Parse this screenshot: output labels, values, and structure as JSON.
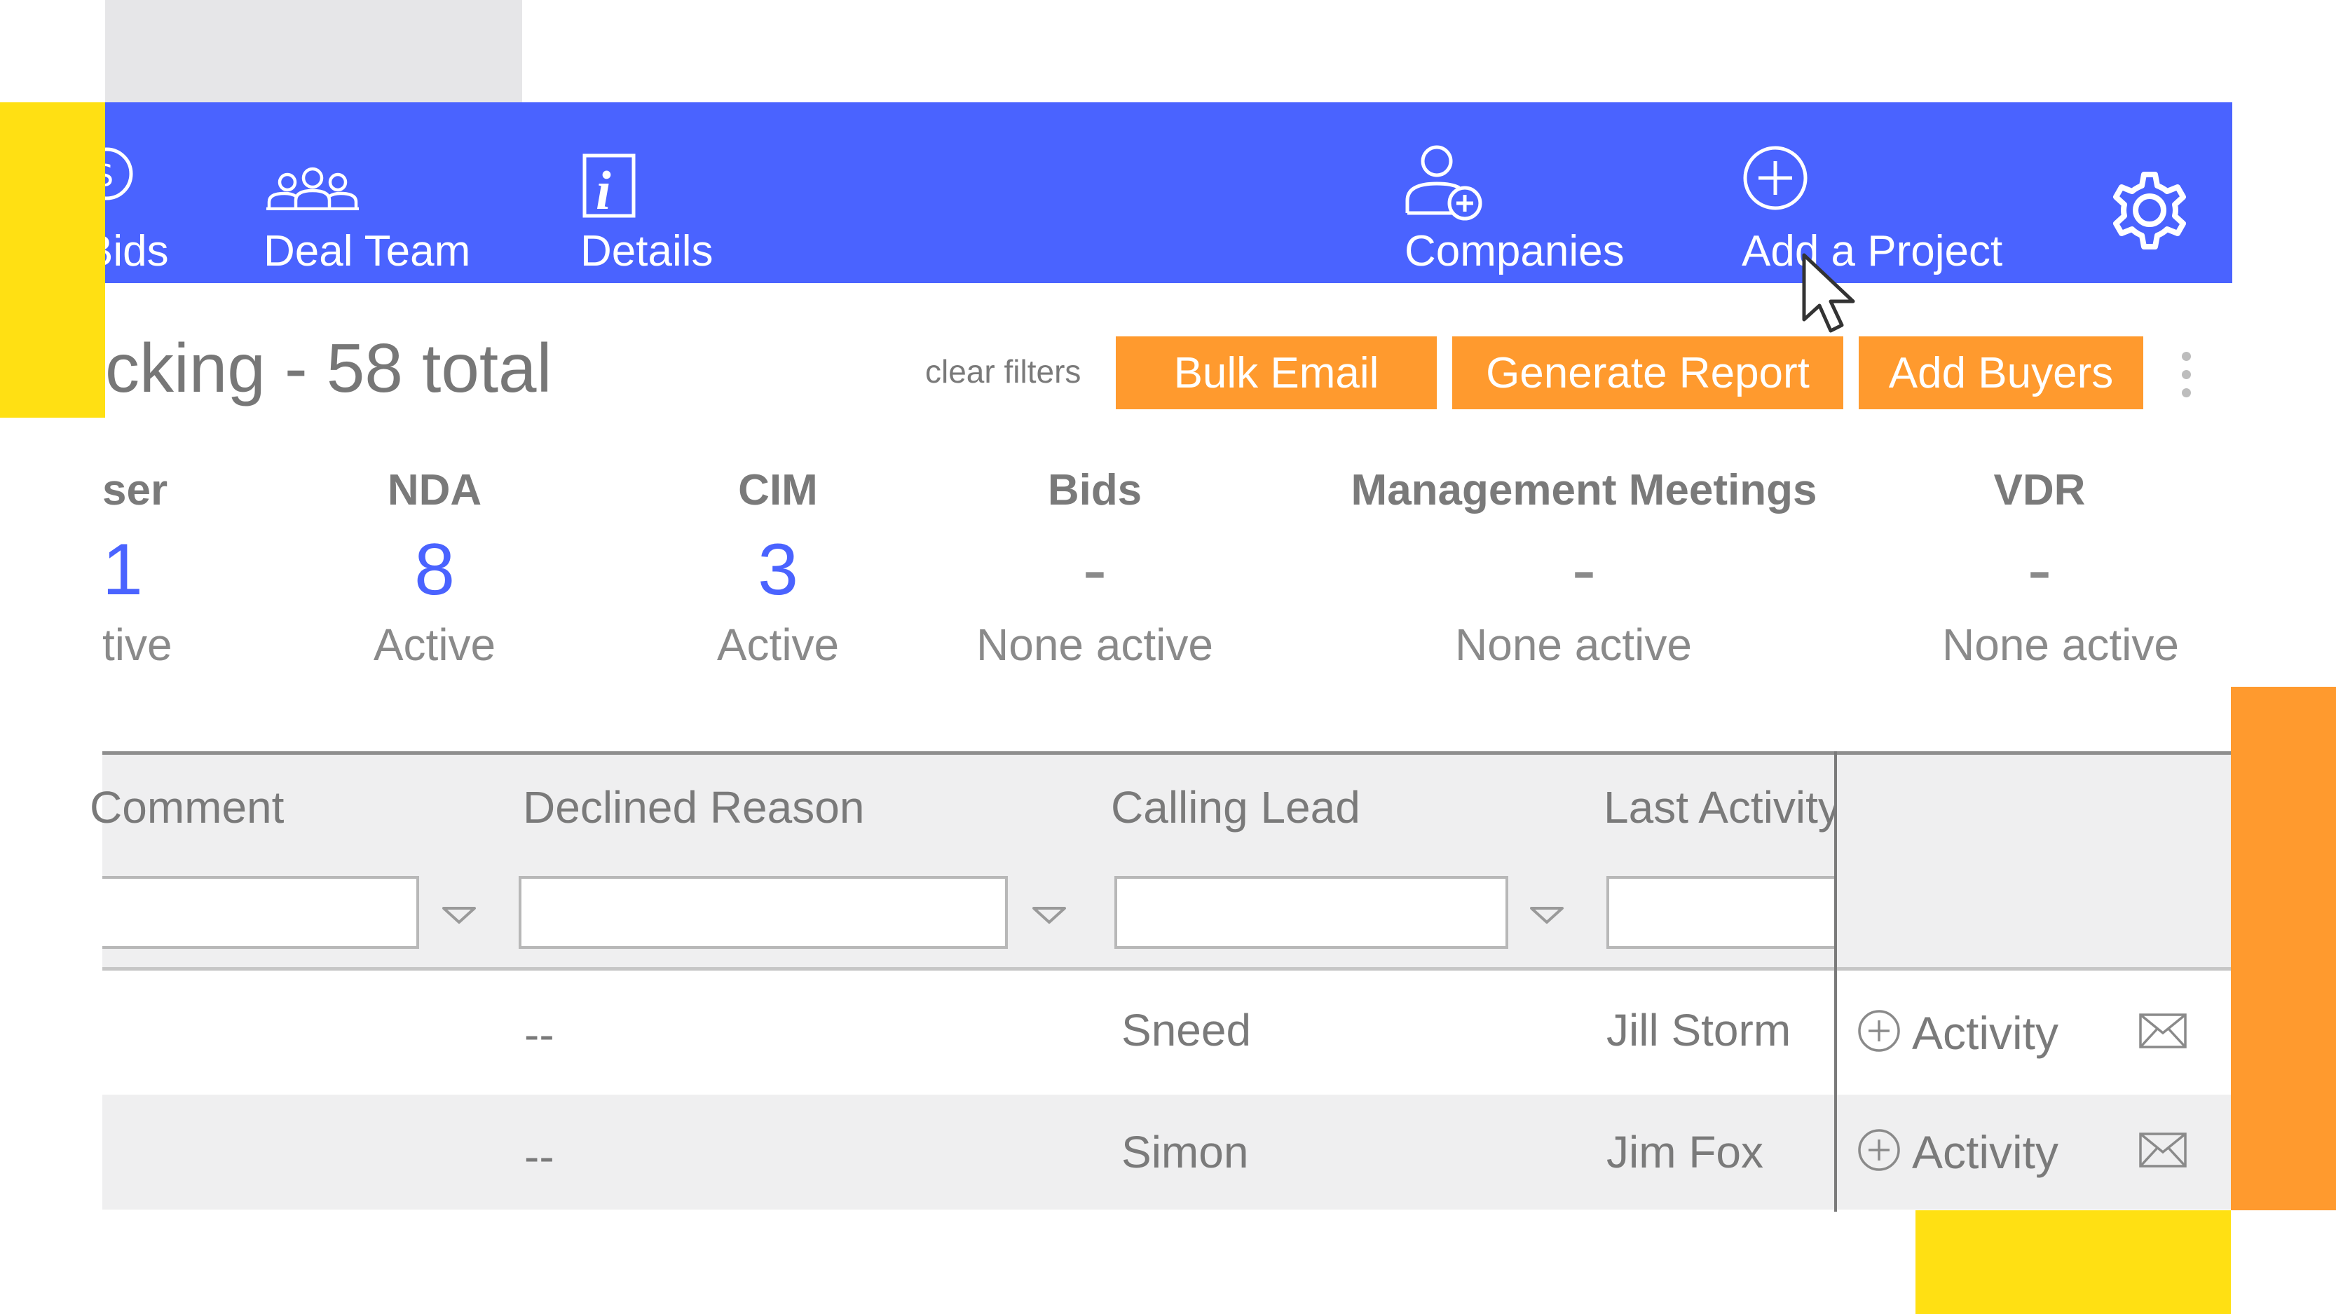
{
  "nav": {
    "items": [
      {
        "label": "Bids",
        "icon": "dollar-circle-icon"
      },
      {
        "label": "Deal Team",
        "icon": "group-icon"
      },
      {
        "label": "Details",
        "icon": "info-icon"
      },
      {
        "label": "Companies",
        "icon": "add-user-icon"
      },
      {
        "label": "Add a Project",
        "icon": "plus-circle-icon"
      }
    ],
    "settings_icon": "gear-icon"
  },
  "header": {
    "title": "cking - 58 total",
    "clear_filters": "clear filters",
    "buttons": [
      "Bulk Email",
      "Generate Report",
      "Add Buyers"
    ],
    "more_icon": "vertical-dots-icon"
  },
  "stages": [
    {
      "name": "ser",
      "count": "1",
      "status": "tive"
    },
    {
      "name": "NDA",
      "count": "8",
      "status": "Active"
    },
    {
      "name": "CIM",
      "count": "3",
      "status": "Active"
    },
    {
      "name": "Bids",
      "count": "-",
      "status": "None active"
    },
    {
      "name": "Management Meetings",
      "count": "-",
      "status": "None active"
    },
    {
      "name": "VDR",
      "count": "-",
      "status": "None active"
    }
  ],
  "table": {
    "columns": [
      "Comment",
      "Declined Reason",
      "Calling Lead",
      "Last Activity"
    ],
    "rows": [
      {
        "declined_reason": "--",
        "calling_lead": "Sneed",
        "last_activity": "Jill Storm",
        "action": "Activity"
      },
      {
        "declined_reason": "--",
        "calling_lead": "Simon",
        "last_activity": "Jim Fox",
        "action": "Activity"
      }
    ]
  },
  "colors": {
    "nav_bg": "#4a63ff",
    "button_bg": "#ff9a2e",
    "accent_yellow": "#ffe013",
    "count_blue": "#4a63ff"
  }
}
